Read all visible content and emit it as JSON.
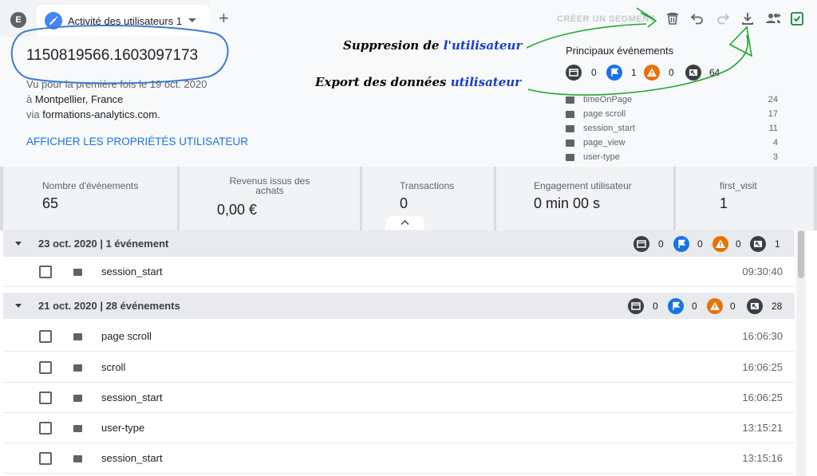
{
  "tabbar": {
    "segment_badge": "E",
    "tab_label": "Activité des utilisateurs 1",
    "add_tab_symbol": "+",
    "create_segment": "CRÉER UN SEGMENT",
    "icons": [
      "edit-icon",
      "chevron-down-icon",
      "add-icon",
      "trash-icon",
      "undo-icon",
      "redo-icon",
      "download-icon",
      "share-users-icon",
      "check-icon"
    ]
  },
  "user": {
    "id": "1150819566.1603097173",
    "first_seen_prefix": "Vu pour la première fois le",
    "first_seen_date": "19 oct. 2020",
    "location_prefix": "à",
    "location": "Montpellier, France",
    "via_prefix": "via",
    "via": "formations-analytics.com.",
    "properties_link": "AFFICHER LES PROPRIÉTÉS UTILISATEUR"
  },
  "top_events": {
    "title": "Principaux événements",
    "counts": [
      {
        "icon": "screen-icon",
        "value": "0",
        "color": "#3c4043"
      },
      {
        "icon": "flag-icon",
        "value": "1",
        "color": "#1a73e8"
      },
      {
        "icon": "warning-icon",
        "value": "0",
        "color": "#e8710a"
      },
      {
        "icon": "cursor-icon",
        "value": "64",
        "color": "#3c4043"
      }
    ],
    "events": [
      {
        "name": "timeOnPage",
        "count": "24"
      },
      {
        "name": "page scroll",
        "count": "17"
      },
      {
        "name": "session_start",
        "count": "11"
      },
      {
        "name": "page_view",
        "count": "4"
      },
      {
        "name": "user-type",
        "count": "3"
      }
    ]
  },
  "summary": {
    "cards": [
      {
        "label": "Nombre d'événements",
        "value": "65"
      },
      {
        "label": "Revenus issus des achats",
        "value": "0,00 €"
      },
      {
        "label": "Transactions",
        "value": "0"
      },
      {
        "label": "Engagement utilisateur",
        "value": "0 min 00 s"
      },
      {
        "label": "first_visit",
        "value": "1"
      }
    ]
  },
  "timeline": {
    "days": [
      {
        "label": "23 oct. 2020 | 1 événement",
        "counts": [
          "0",
          "0",
          "0",
          "1"
        ],
        "events": [
          {
            "name": "session_start",
            "time": "09:30:40"
          }
        ]
      },
      {
        "label": "21 oct. 2020 | 28 événements",
        "counts": [
          "0",
          "0",
          "0",
          "28"
        ],
        "events": [
          {
            "name": "page scroll",
            "time": "16:06:30"
          },
          {
            "name": "scroll",
            "time": "16:06:25"
          },
          {
            "name": "session_start",
            "time": "16:06:25"
          },
          {
            "name": "user-type",
            "time": "13:15:21"
          },
          {
            "name": "session_start",
            "time": "13:15:16"
          }
        ]
      }
    ]
  },
  "annotations": {
    "delete_prefix": "Suppresion de",
    "delete_highlight": "l'utilisateur",
    "export_prefix": "Export des données",
    "export_highlight": "utilisateur"
  },
  "colors": {
    "accent": "#1a73e8",
    "annotation_green": "#1fa82b",
    "annotation_blue": "#3a7bd5"
  }
}
